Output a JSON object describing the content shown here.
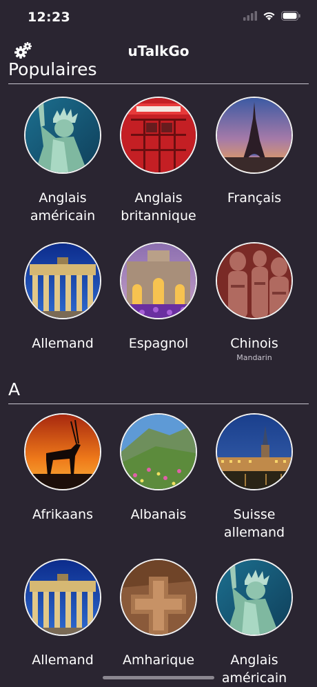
{
  "status_bar": {
    "time": "12:23"
  },
  "header": {
    "title": "uTalkGo"
  },
  "sections": [
    {
      "title": "Populaires",
      "items": [
        {
          "name": "Anglais\naméricain",
          "subtitle": "",
          "image": "statue-of-liberty"
        },
        {
          "name": "Anglais\nbritannique",
          "subtitle": "",
          "image": "red-telephone-box"
        },
        {
          "name": "Français",
          "subtitle": "",
          "image": "eiffel-tower"
        },
        {
          "name": "Allemand",
          "subtitle": "",
          "image": "brandenburg-gate"
        },
        {
          "name": "Espagnol",
          "subtitle": "",
          "image": "puerta-de-alcala"
        },
        {
          "name": "Chinois",
          "subtitle": "Mandarin",
          "image": "terracotta-warriors"
        }
      ]
    },
    {
      "title": "A",
      "items": [
        {
          "name": "Afrikaans",
          "subtitle": "",
          "image": "oryx-sunset"
        },
        {
          "name": "Albanais",
          "subtitle": "",
          "image": "mountain-meadow"
        },
        {
          "name": "Suisse\nallemand",
          "subtitle": "",
          "image": "zurich-night"
        },
        {
          "name": "Allemand",
          "subtitle": "",
          "image": "brandenburg-gate"
        },
        {
          "name": "Amharique",
          "subtitle": "",
          "image": "rock-church"
        },
        {
          "name": "Anglais\naméricain",
          "subtitle": "",
          "image": "statue-of-liberty"
        }
      ]
    }
  ],
  "colors": {
    "background": "#2a2531",
    "divider": "#c9c5cf",
    "ring": "#f2f2f2"
  }
}
